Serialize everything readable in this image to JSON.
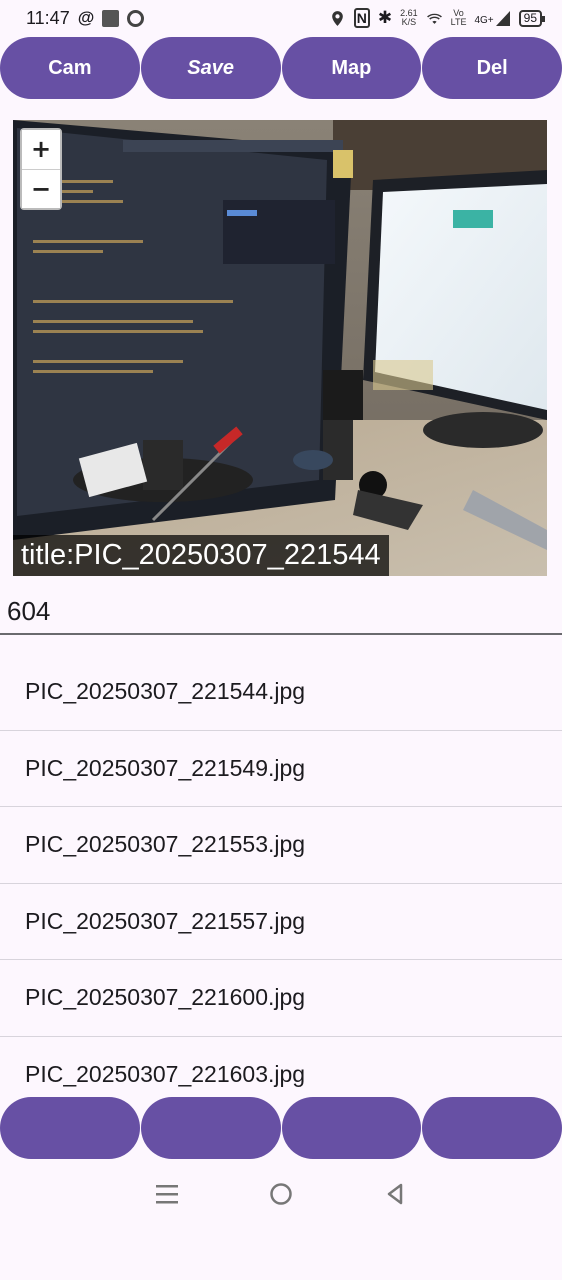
{
  "status_bar": {
    "time": "11:47",
    "network_speed": "2.61",
    "network_unit": "K/S",
    "volte": "Vo",
    "volte_sub": "LTE",
    "signal": "4G+",
    "battery": "95"
  },
  "toolbar": {
    "cam_label": "Cam",
    "save_label": "Save",
    "map_label": "Map",
    "del_label": "Del"
  },
  "viewer": {
    "zoom_in": "+",
    "zoom_out": "−",
    "caption": "title:PIC_20250307_221544"
  },
  "count_field": {
    "value": "604"
  },
  "files": [
    "PIC_20250307_221544.jpg",
    "PIC_20250307_221549.jpg",
    "PIC_20250307_221553.jpg",
    "PIC_20250307_221557.jpg",
    "PIC_20250307_221600.jpg",
    "PIC_20250307_221603.jpg"
  ],
  "bottom_buttons": [
    "",
    "",
    "",
    ""
  ],
  "colors": {
    "accent": "#6750a4",
    "background": "#fdf7fe"
  }
}
